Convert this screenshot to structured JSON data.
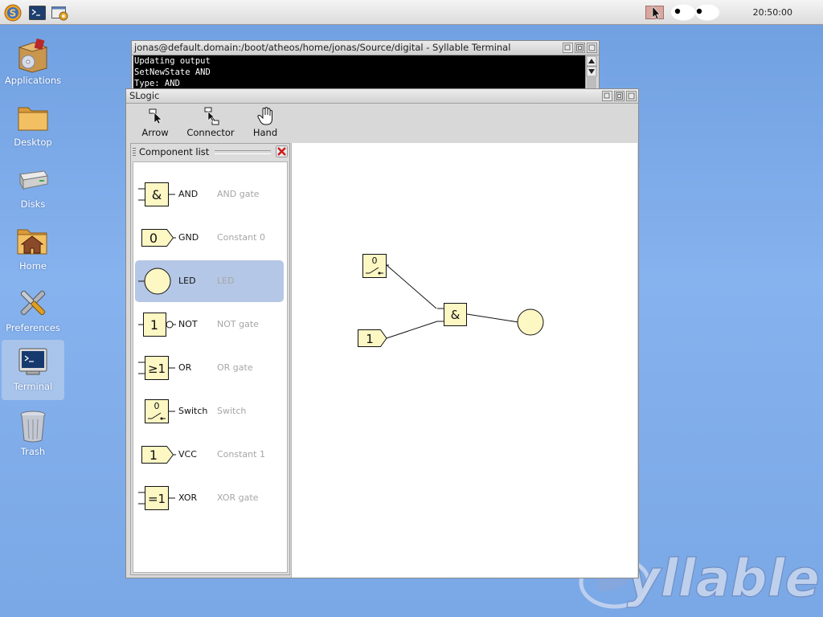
{
  "top_panel": {
    "clock": "20:50:00"
  },
  "desktop_icons": [
    {
      "label": "Applications"
    },
    {
      "label": "Desktop"
    },
    {
      "label": "Disks"
    },
    {
      "label": "Home"
    },
    {
      "label": "Preferences"
    },
    {
      "label": "Terminal",
      "selected": true
    },
    {
      "label": "Trash"
    }
  ],
  "terminal": {
    "title": "jonas@default.domain:/boot/atheos/home/jonas/Source/digital - Syllable Terminal",
    "lines": [
      "Updating output",
      "SetNewState AND",
      "Type: AND"
    ]
  },
  "slogic": {
    "title": "SLogic",
    "tools": [
      {
        "label": "Arrow"
      },
      {
        "label": "Connector"
      },
      {
        "label": "Hand"
      }
    ],
    "component_panel": {
      "title": "Component list",
      "items": [
        {
          "name": "AND",
          "desc": "AND gate",
          "symbol": "&"
        },
        {
          "name": "GND",
          "desc": "Constant 0",
          "symbol": "0"
        },
        {
          "name": "LED",
          "desc": "LED",
          "symbol": "",
          "selected": true
        },
        {
          "name": "NOT",
          "desc": "NOT gate",
          "symbol": "1"
        },
        {
          "name": "OR",
          "desc": "OR gate",
          "symbol": "≥1"
        },
        {
          "name": "Switch",
          "desc": "Switch",
          "symbol": "0"
        },
        {
          "name": "VCC",
          "desc": "Constant 1",
          "symbol": "1"
        },
        {
          "name": "XOR",
          "desc": "XOR gate",
          "symbol": "=1"
        }
      ]
    },
    "canvas": {
      "switch_label": "0",
      "vcc_label": "1",
      "and_label": "&"
    }
  },
  "logo_text": "yllable",
  "colors": {
    "desktop_bg": "#7aa8e6",
    "gate_fill": "#fdf7c4",
    "selection": "#b5c7e6"
  }
}
